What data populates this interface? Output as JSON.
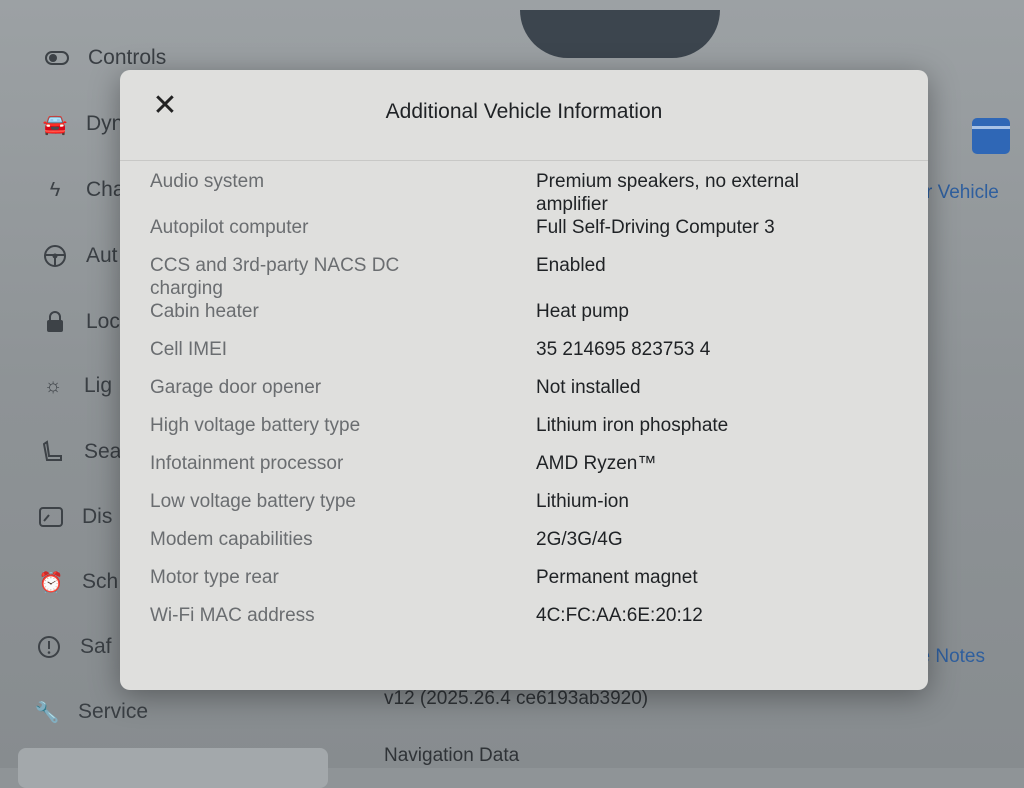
{
  "sidebar": {
    "items": [
      {
        "label": "Controls",
        "icon": "toggle-icon"
      },
      {
        "label": "Dyn",
        "icon": "car-icon"
      },
      {
        "label": "Cha",
        "icon": "bolt-icon"
      },
      {
        "label": "Aut",
        "icon": "steering-wheel-icon"
      },
      {
        "label": "Loc",
        "icon": "lock-icon"
      },
      {
        "label": "Lig",
        "icon": "light-icon"
      },
      {
        "label": "Sea",
        "icon": "seat-icon"
      },
      {
        "label": "Dis",
        "icon": "display-icon"
      },
      {
        "label": "Sch",
        "icon": "alarm-clock-icon"
      },
      {
        "label": "Saf",
        "icon": "info-circle-icon"
      },
      {
        "label": "Service",
        "icon": "wrench-icon"
      }
    ]
  },
  "background": {
    "vehicle_link": "r Vehicle",
    "release_notes_link": "se Notes",
    "version_text": "v12 (2025.26.4 ce6193ab3920)",
    "navigation_data_label": "Navigation Data"
  },
  "modal": {
    "title": "Additional Vehicle Information",
    "close_label": "✕",
    "rows": [
      {
        "key": "Audio system",
        "value": "Premium speakers, no external amplifier"
      },
      {
        "key": "Autopilot computer",
        "value": "Full Self-Driving Computer 3"
      },
      {
        "key": "CCS and 3rd-party NACS DC charging",
        "value": "Enabled"
      },
      {
        "key": "Cabin heater",
        "value": "Heat pump"
      },
      {
        "key": "Cell IMEI",
        "value": "35 214695 823753 4"
      },
      {
        "key": "Garage door opener",
        "value": "Not installed"
      },
      {
        "key": "High voltage battery type",
        "value": "Lithium iron phosphate"
      },
      {
        "key": "Infotainment processor",
        "value": "AMD Ryzen™"
      },
      {
        "key": "Low voltage battery type",
        "value": "Lithium-ion"
      },
      {
        "key": "Modem capabilities",
        "value": "2G/3G/4G"
      },
      {
        "key": "Motor type rear",
        "value": "Permanent magnet"
      },
      {
        "key": "Wi-Fi MAC address",
        "value": "4C:FC:AA:6E:20:12"
      }
    ]
  }
}
